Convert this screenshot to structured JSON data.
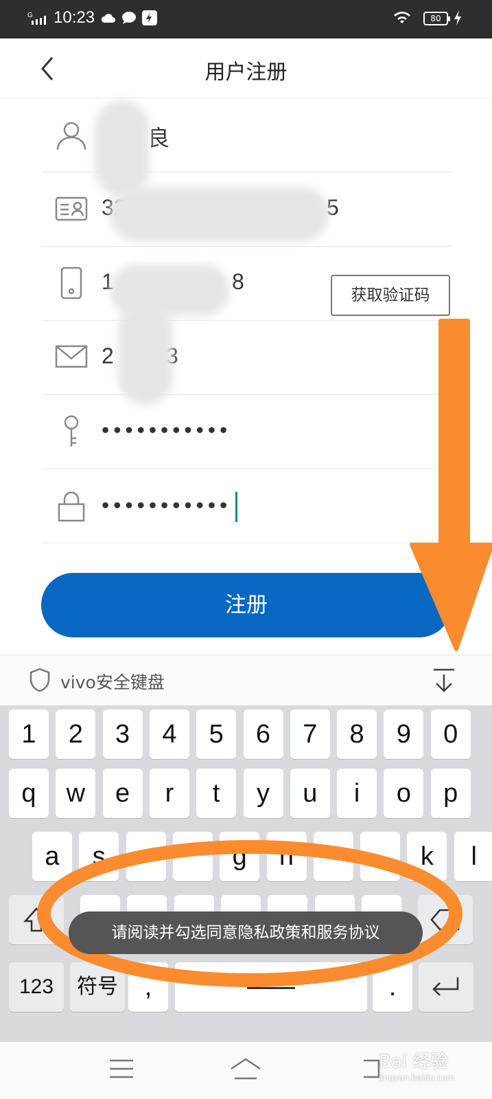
{
  "status_bar": {
    "time": "10:23",
    "signal": "G",
    "battery": "80"
  },
  "header": {
    "title": "用户注册"
  },
  "form": {
    "name": "良",
    "id_number_start": "32",
    "id_number_end": "5",
    "phone_start": "1",
    "phone_end": "8",
    "email_start": "2",
    "email_end": "3",
    "get_code_label": "获取验证码",
    "password": "•••••••••••",
    "confirm_password": "•••••••••••",
    "register_label": "注册"
  },
  "keyboard": {
    "title": "vivo安全键盘",
    "row_numbers": [
      "1",
      "2",
      "3",
      "4",
      "5",
      "6",
      "7",
      "8",
      "9",
      "0"
    ],
    "row_top": [
      "q",
      "w",
      "e",
      "r",
      "t",
      "y",
      "u",
      "i",
      "o",
      "p"
    ],
    "row_mid": [
      "a",
      "s",
      "",
      "",
      "g",
      "h",
      "",
      "",
      "k",
      "l"
    ],
    "key_123": "123",
    "key_symbols": "符号",
    "key_comma": ",",
    "key_period": "."
  },
  "toast": {
    "text": "请阅读并勾选同意隐私政策和服务协议"
  },
  "watermark": {
    "brand": "Bai 经验",
    "url": "jingyan.baidu.com"
  },
  "colors": {
    "accent": "#0867c2",
    "annotation": "#fa8c2f",
    "caret": "#0b8a80"
  }
}
